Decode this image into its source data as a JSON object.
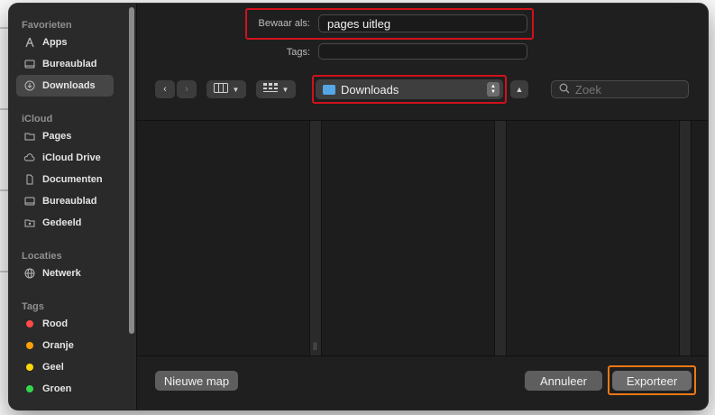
{
  "dialog": {
    "save_as_label": "Bewaar als:",
    "save_as_value": "pages uitleg",
    "tags_label": "Tags:",
    "tags_value": ""
  },
  "sidebar": {
    "sections": [
      {
        "title": "Favorieten"
      },
      {
        "title": "iCloud"
      },
      {
        "title": "Locaties"
      },
      {
        "title": "Tags"
      }
    ],
    "favorites": [
      {
        "label": "Apps",
        "icon": "apps-icon"
      },
      {
        "label": "Bureaublad",
        "icon": "desktop-icon"
      },
      {
        "label": "Downloads",
        "icon": "downloads-icon",
        "active": true
      }
    ],
    "icloud": [
      {
        "label": "Pages",
        "icon": "folder-icon"
      },
      {
        "label": "iCloud Drive",
        "icon": "cloud-icon"
      },
      {
        "label": "Documenten",
        "icon": "document-icon"
      },
      {
        "label": "Bureaublad",
        "icon": "desktop-icon"
      },
      {
        "label": "Gedeeld",
        "icon": "shared-folder-icon"
      }
    ],
    "locations": [
      {
        "label": "Netwerk",
        "icon": "network-icon"
      }
    ],
    "tags": [
      {
        "label": "Rood",
        "color": "#ff4a4a"
      },
      {
        "label": "Oranje",
        "color": "#ff9f0a"
      },
      {
        "label": "Geel",
        "color": "#ffd60a"
      },
      {
        "label": "Groen",
        "color": "#32d74b"
      }
    ]
  },
  "toolbar": {
    "folder": "Downloads",
    "search_placeholder": "Zoek"
  },
  "buttons": {
    "new_folder": "Nieuwe map",
    "cancel": "Annuleer",
    "export": "Exporteer"
  }
}
